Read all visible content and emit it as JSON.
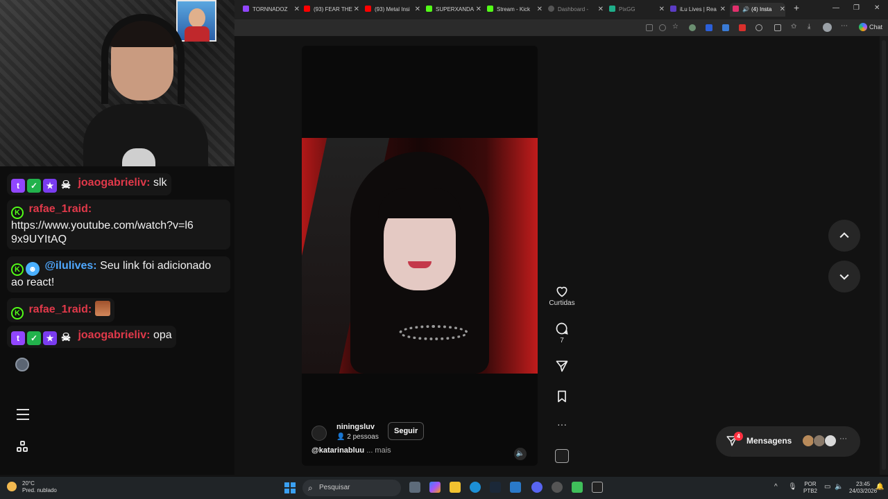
{
  "browser": {
    "tabs": [
      {
        "label": "TORNNADOZ",
        "color": "#9146ff"
      },
      {
        "label": "(93) FEAR THE",
        "color": "#ff0000"
      },
      {
        "label": "(93) Metal Insi",
        "color": "#ff0000"
      },
      {
        "label": "SUPERXANDA",
        "color": "#53fc18"
      },
      {
        "label": "Stream - Kick",
        "color": "#53fc18"
      },
      {
        "label": "Dashboard -",
        "color": "#8a8a8a"
      },
      {
        "label": "PixGG",
        "color": "#1fae8a"
      },
      {
        "label": "iLu Lives | Rea",
        "color": "#5b3cc4"
      },
      {
        "label": "(4) Insta",
        "color": "#e1306c"
      }
    ],
    "chat_button": "Chat"
  },
  "chat": {
    "messages": [
      {
        "user": "joaogabrieliv:",
        "text": "slk"
      },
      {
        "user": "rafae_1raid:",
        "text": "https://www.youtube.com/watch?v=l69x9UYItAQ"
      },
      {
        "user": "@ilulives:",
        "text": "Seu link foi adicionado ao react!"
      },
      {
        "user": "rafae_1raid:",
        "text": ""
      },
      {
        "user": "joaogabrieliv:",
        "text": "opa"
      }
    ]
  },
  "reel": {
    "username": "niningsluv",
    "people": "2 pessoas",
    "follow": "Seguir",
    "caption_user": "@katarinabluu",
    "caption_more": "... mais"
  },
  "actions": {
    "likes_label": "Curtidas",
    "comments_count": "7"
  },
  "messages": {
    "label": "Mensagens",
    "badge": "4"
  },
  "taskbar": {
    "temp": "20°C",
    "weather": "Pred. nublado",
    "search": "Pesquisar",
    "lang1": "POR",
    "lang2": "PTB2",
    "time": "23:45",
    "date": "24/03/2026"
  },
  "colors": {
    "twitch": "#9146ff",
    "kick": "#53fc18",
    "username_red": "#e1394a",
    "username_blue": "#4fa8ff",
    "instagram_badge": "#ff3040"
  }
}
